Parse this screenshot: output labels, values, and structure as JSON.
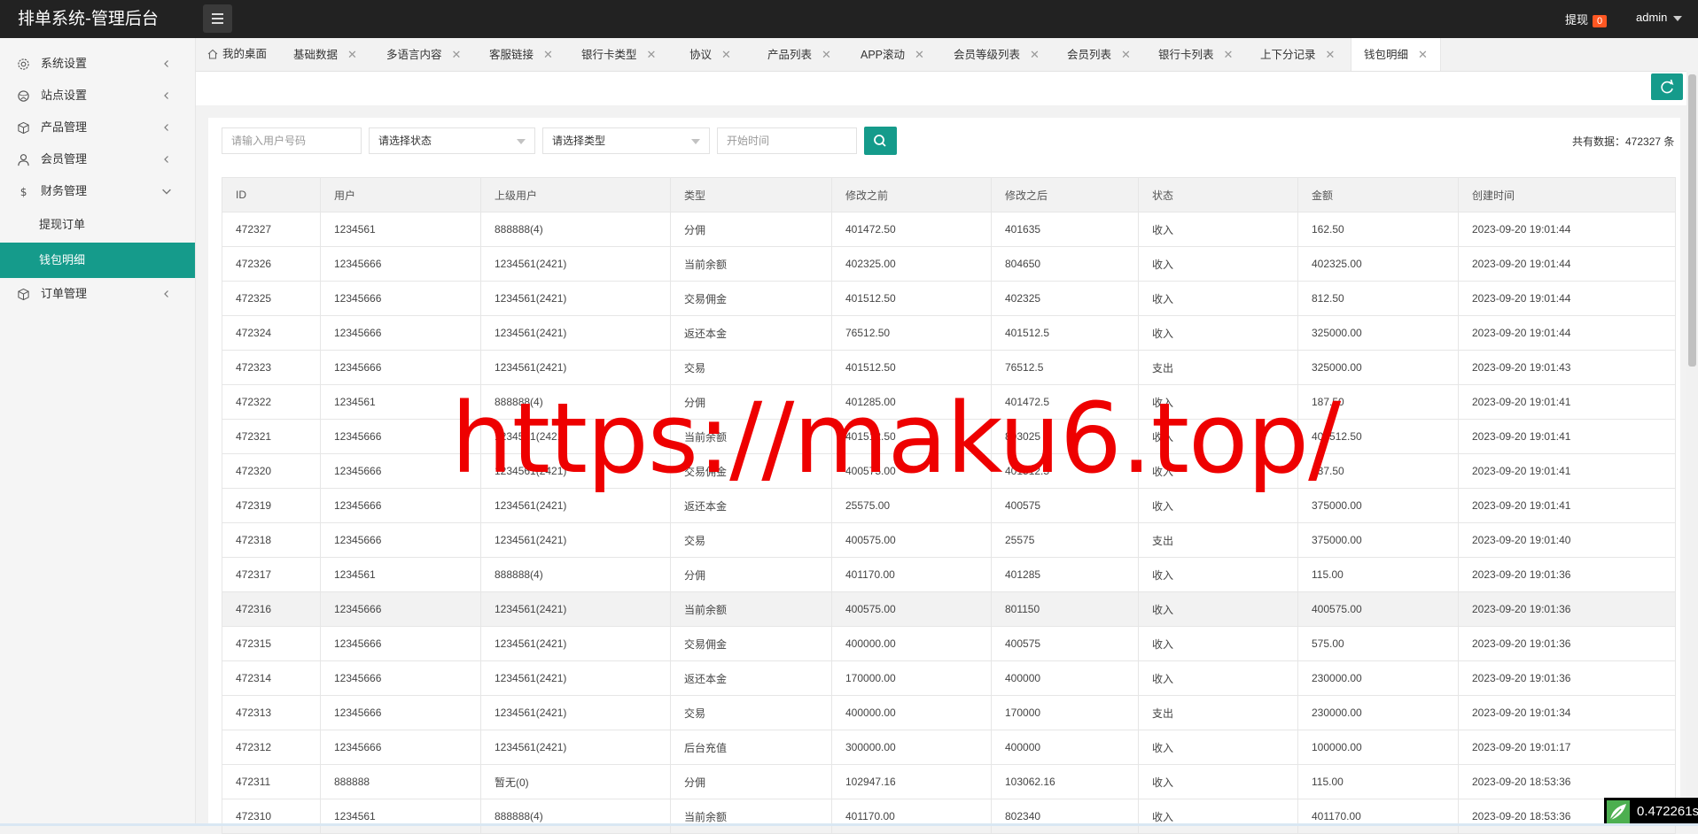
{
  "app": {
    "title": "排单系统-管理后台"
  },
  "header": {
    "withdraw_label": "提现",
    "withdraw_count": "0",
    "user_name": "admin"
  },
  "sidebar": {
    "items": [
      {
        "label": "系统设置",
        "icon": "gear-icon"
      },
      {
        "label": "站点设置",
        "icon": "globe-icon"
      },
      {
        "label": "产品管理",
        "icon": "cube-icon"
      },
      {
        "label": "会员管理",
        "icon": "user-icon"
      },
      {
        "label": "财务管理",
        "icon": "dollar-icon",
        "expanded": true,
        "children": [
          {
            "label": "提现订单",
            "active": false
          },
          {
            "label": "钱包明细",
            "active": true
          }
        ]
      },
      {
        "label": "订单管理",
        "icon": "cube-icon"
      }
    ]
  },
  "tabs": [
    {
      "label": "我的桌面",
      "closable": false
    },
    {
      "label": "基础数据",
      "closable": true
    },
    {
      "label": "多语言内容",
      "closable": true
    },
    {
      "label": "客服链接",
      "closable": true
    },
    {
      "label": "银行卡类型",
      "closable": true
    },
    {
      "label": "协议",
      "closable": true
    },
    {
      "label": "产品列表",
      "closable": true
    },
    {
      "label": "APP滚动",
      "closable": true
    },
    {
      "label": "会员等级列表",
      "closable": true
    },
    {
      "label": "会员列表",
      "closable": true
    },
    {
      "label": "银行卡列表",
      "closable": true
    },
    {
      "label": "上下分记录",
      "closable": true
    },
    {
      "label": "钱包明细",
      "closable": true,
      "active": true
    }
  ],
  "filters": {
    "user_placeholder": "请输入用户号码",
    "status_select": "请选择状态",
    "type_select": "请选择类型",
    "time_placeholder": "开始时间"
  },
  "total_label": "共有数据：472327 条",
  "table": {
    "columns": [
      "ID",
      "用户",
      "上级用户",
      "类型",
      "修改之前",
      "修改之后",
      "状态",
      "金额",
      "创建时间"
    ],
    "rows": [
      [
        "472327",
        "1234561",
        "888888(4)",
        "分佣",
        "401472.50",
        "401635",
        "收入",
        "162.50",
        "2023-09-20 19:01:44"
      ],
      [
        "472326",
        "12345666",
        "1234561(2421)",
        "当前余额",
        "402325.00",
        "804650",
        "收入",
        "402325.00",
        "2023-09-20 19:01:44"
      ],
      [
        "472325",
        "12345666",
        "1234561(2421)",
        "交易佣金",
        "401512.50",
        "402325",
        "收入",
        "812.50",
        "2023-09-20 19:01:44"
      ],
      [
        "472324",
        "12345666",
        "1234561(2421)",
        "返还本金",
        "76512.50",
        "401512.5",
        "收入",
        "325000.00",
        "2023-09-20 19:01:44"
      ],
      [
        "472323",
        "12345666",
        "1234561(2421)",
        "交易",
        "401512.50",
        "76512.5",
        "支出",
        "325000.00",
        "2023-09-20 19:01:43"
      ],
      [
        "472322",
        "1234561",
        "888888(4)",
        "分佣",
        "401285.00",
        "401472.5",
        "收入",
        "187.50",
        "2023-09-20 19:01:41"
      ],
      [
        "472321",
        "12345666",
        "1234561(2421)",
        "当前余额",
        "401512.50",
        "803025",
        "收入",
        "401512.50",
        "2023-09-20 19:01:41"
      ],
      [
        "472320",
        "12345666",
        "1234561(2421)",
        "交易佣金",
        "400575.00",
        "401512.5",
        "收入",
        "937.50",
        "2023-09-20 19:01:41"
      ],
      [
        "472319",
        "12345666",
        "1234561(2421)",
        "返还本金",
        "25575.00",
        "400575",
        "收入",
        "375000.00",
        "2023-09-20 19:01:41"
      ],
      [
        "472318",
        "12345666",
        "1234561(2421)",
        "交易",
        "400575.00",
        "25575",
        "支出",
        "375000.00",
        "2023-09-20 19:01:40"
      ],
      [
        "472317",
        "1234561",
        "888888(4)",
        "分佣",
        "401170.00",
        "401285",
        "收入",
        "115.00",
        "2023-09-20 19:01:36"
      ],
      [
        "472316",
        "12345666",
        "1234561(2421)",
        "当前余额",
        "400575.00",
        "801150",
        "收入",
        "400575.00",
        "2023-09-20 19:01:36"
      ],
      [
        "472315",
        "12345666",
        "1234561(2421)",
        "交易佣金",
        "400000.00",
        "400575",
        "收入",
        "575.00",
        "2023-09-20 19:01:36"
      ],
      [
        "472314",
        "12345666",
        "1234561(2421)",
        "返还本金",
        "170000.00",
        "400000",
        "收入",
        "230000.00",
        "2023-09-20 19:01:36"
      ],
      [
        "472313",
        "12345666",
        "1234561(2421)",
        "交易",
        "400000.00",
        "170000",
        "支出",
        "230000.00",
        "2023-09-20 19:01:34"
      ],
      [
        "472312",
        "12345666",
        "1234561(2421)",
        "后台充值",
        "300000.00",
        "400000",
        "收入",
        "100000.00",
        "2023-09-20 19:01:17"
      ],
      [
        "472311",
        "888888",
        "暂无(0)",
        "分佣",
        "102947.16",
        "103062.16",
        "收入",
        "115.00",
        "2023-09-20 18:53:36"
      ],
      [
        "472310",
        "1234561",
        "888888(4)",
        "当前余额",
        "401170.00",
        "802340",
        "收入",
        "401170.00",
        "2023-09-20 18:53:36"
      ]
    ],
    "highlighted_row": 11
  },
  "watermark": "https://maku6.top/",
  "timer": "0.472261s",
  "colors": {
    "topbar": "#222222",
    "accent": "#159b8b",
    "badge": "#ff5722",
    "watermark": "#ee0000"
  }
}
